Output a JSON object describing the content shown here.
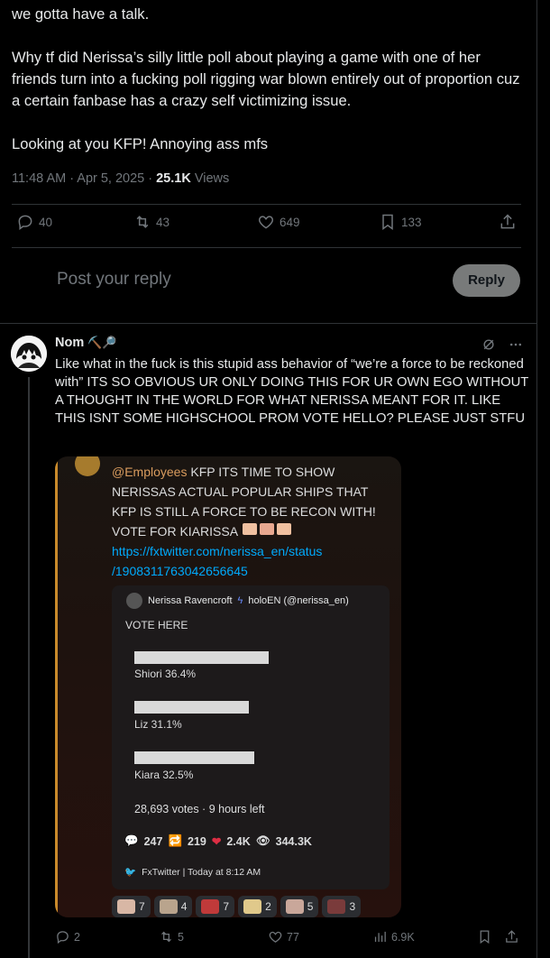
{
  "tweet": {
    "text": "we gotta have a talk.\n\nWhy tf did Nerissa’s silly little poll about playing a game with one of her friends turn into a fucking poll rigging war blown entirely out of proportion cuz a certain fanbase has a crazy self victimizing issue.\n\nLooking at you KFP! Annoying ass mfs",
    "time": "11:48 AM · Apr 5, 2025 ·",
    "views_count": "25.1K",
    "views_label": "Views",
    "replies": "40",
    "reposts": "43",
    "likes": "649",
    "bookmarks": "133"
  },
  "compose": {
    "placeholder": "Post your reply",
    "button": "Reply"
  },
  "reply": {
    "name": "Nom",
    "name_emojis": "⛏️🔎",
    "text": "Like what in the fuck is this stupid ass behavior of “we’re a force to be reckoned with” ITS SO OBVIOUS UR ONLY DOING THIS FOR UR OWN EGO WITHOUT A THOUGHT IN THE WORLD FOR WHAT NERISSA MEANT FOR IT. LIKE THIS ISNT SOME HIGHSCHOOL PROM VOTE HELLO?  PLEASE JUST STFU",
    "replies": "2",
    "reposts": "5",
    "likes": "77",
    "views": "6.9K"
  },
  "embed": {
    "mention": "@Employees",
    "message": " KFP ITS TIME TO SHOW NERISSAS ACTUAL POPULAR SHIPS THAT KFP IS STILL A FORCE TO BE RECON WITH! VOTE FOR KIARISSA",
    "link_line1": "https://fxtwitter.com/nerissa_en/status",
    "link_line2": "/1908311763042656645",
    "card": {
      "author": "Nerissa Ravencroft",
      "author_suffix": "holoEN (@nerissa_en)",
      "body": "VOTE HERE",
      "options": [
        {
          "label": "Shiori   36.4%",
          "pct": 36.4
        },
        {
          "label": "Liz   31.1%",
          "pct": 31.1
        },
        {
          "label": "Kiara   32.5%",
          "pct": 32.5
        }
      ],
      "votes": "28,693 votes · 9 hours left",
      "comments": "247",
      "retweets": "219",
      "likes": "2.4K",
      "views": "344.3K",
      "footer": "FxTwitter | Today at 8:12 AM"
    },
    "reactions": [
      {
        "count": "7",
        "color": "#d8b7a5"
      },
      {
        "count": "4",
        "color": "#b9a48d"
      },
      {
        "count": "7",
        "color": "#c03a3a"
      },
      {
        "count": "2",
        "color": "#e0c98b"
      },
      {
        "count": "5",
        "color": "#c9a79a"
      },
      {
        "count": "3",
        "color": "#7a3b3b"
      }
    ]
  }
}
